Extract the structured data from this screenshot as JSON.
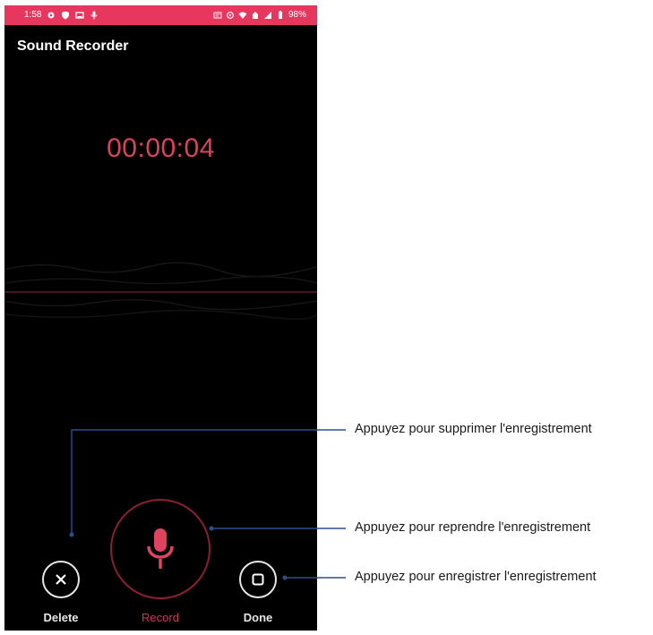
{
  "status_bar": {
    "time": "1:58",
    "battery": "98%",
    "background_color": "#e8375f",
    "left_icons": [
      "settings-icon",
      "shield-icon",
      "cast-icon",
      "mic-icon"
    ],
    "right_icons": [
      "message-icon",
      "sync-icon",
      "wifi-icon",
      "data-icon",
      "signal-icon",
      "battery-icon"
    ]
  },
  "app": {
    "title": "Sound Recorder"
  },
  "recording": {
    "elapsed": "00:00:04",
    "accent_color": "#d8445f"
  },
  "controls": {
    "delete_label": "Delete",
    "record_label": "Record",
    "done_label": "Done"
  },
  "annotations": {
    "delete_note": "Appuyez pour supprimer l'enregistrement",
    "record_note": "Appuyez pour reprendre l'enregistrement",
    "done_note": "Appuyez pour enregistrer l'enregistrement"
  }
}
